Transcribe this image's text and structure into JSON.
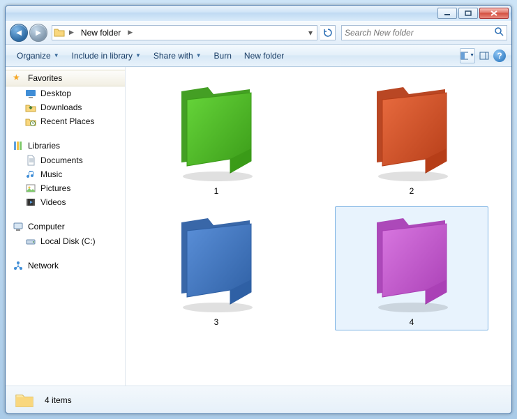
{
  "breadcrumb": {
    "location": "New folder"
  },
  "search": {
    "placeholder": "Search New folder"
  },
  "toolbar": {
    "organize": "Organize",
    "include": "Include in library",
    "share": "Share with",
    "burn": "Burn",
    "newfolder": "New folder"
  },
  "sidebar": {
    "favorites": {
      "label": "Favorites",
      "items": [
        "Desktop",
        "Downloads",
        "Recent Places"
      ]
    },
    "libraries": {
      "label": "Libraries",
      "items": [
        "Documents",
        "Music",
        "Pictures",
        "Videos"
      ]
    },
    "computer": {
      "label": "Computer",
      "items": [
        "Local Disk (C:)"
      ]
    },
    "network": {
      "label": "Network"
    }
  },
  "files": [
    {
      "name": "1",
      "color_light": "#66d53a",
      "color_dark": "#3a9a18",
      "selected": false
    },
    {
      "name": "2",
      "color_light": "#e86b3f",
      "color_dark": "#b53d18",
      "selected": false
    },
    {
      "name": "3",
      "color_light": "#5a8fd8",
      "color_dark": "#2e5fa3",
      "selected": false
    },
    {
      "name": "4",
      "color_light": "#d877e0",
      "color_dark": "#a93fb5",
      "selected": true
    }
  ],
  "status": {
    "count_text": "4 items"
  }
}
